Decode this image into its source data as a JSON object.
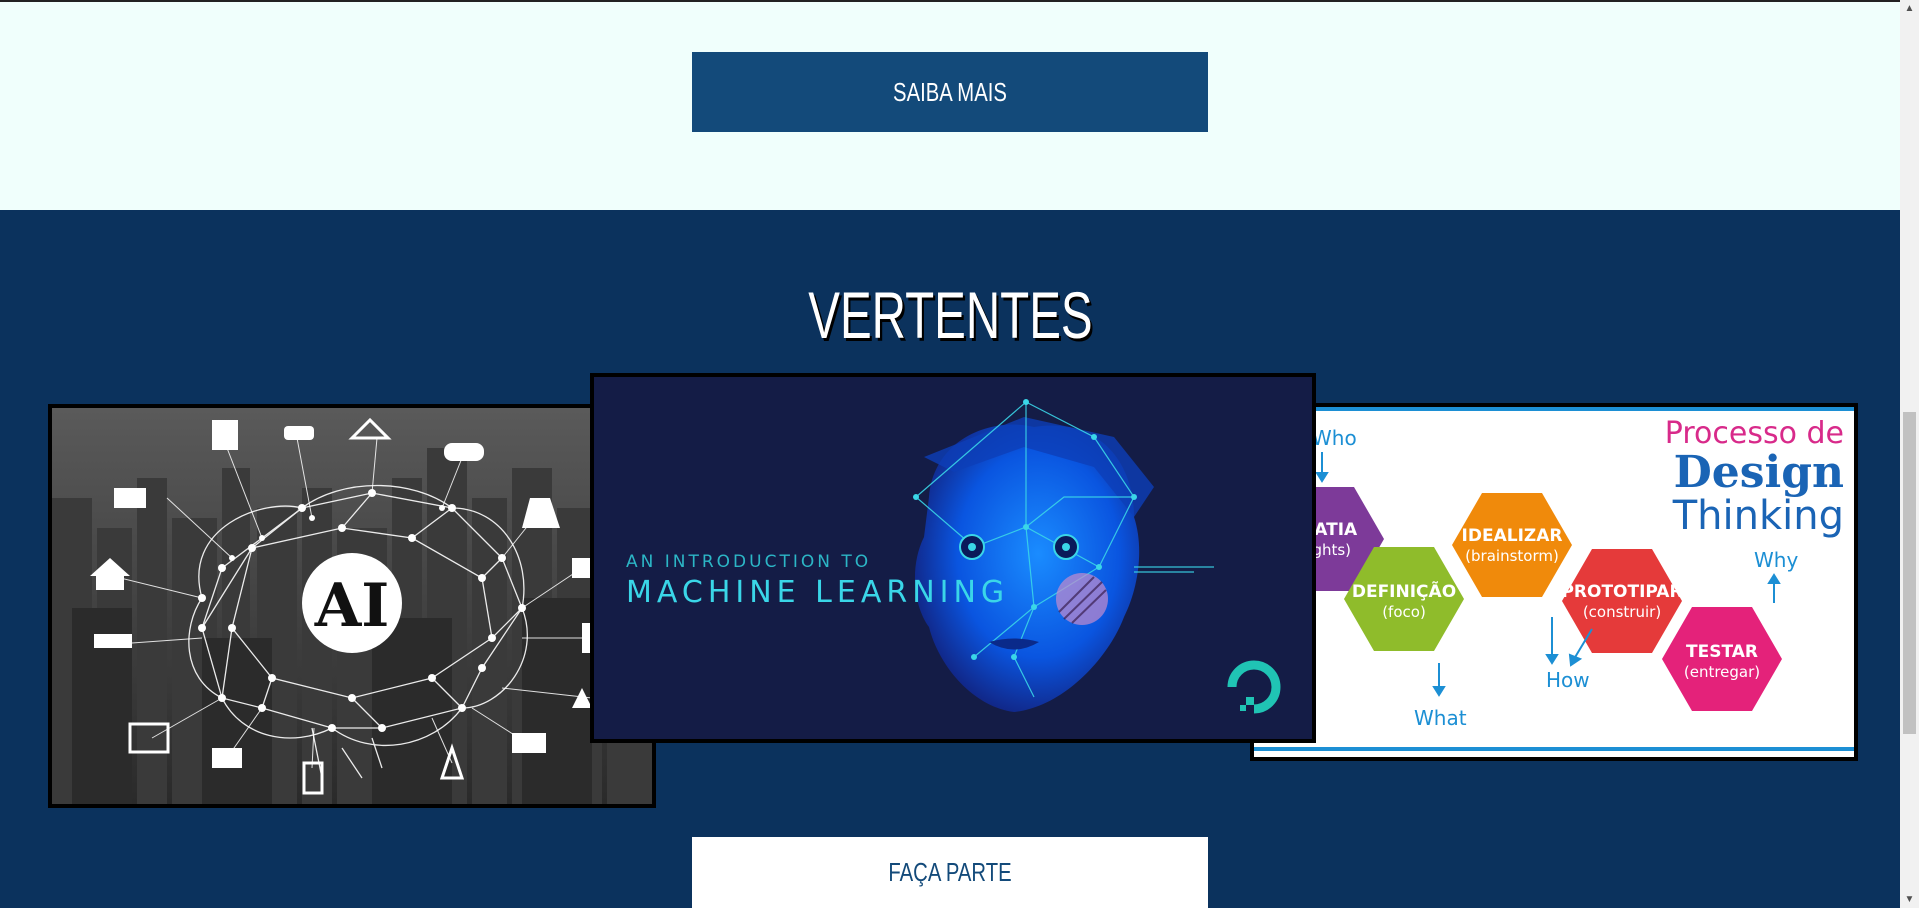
{
  "top_section": {
    "button_label": "SAIBA MAIS"
  },
  "vertentes": {
    "title": "VERTENTES",
    "cards": {
      "ai": {
        "badge": "AI"
      },
      "ml": {
        "subtitle": "AN INTRODUCTION TO",
        "title": "MACHINE LEARNING"
      },
      "dt": {
        "heading_1": "Processo de",
        "heading_2": "Design",
        "heading_3": "Thinking",
        "who": "Who",
        "what": "What",
        "how": "How",
        "why": "Why",
        "steps": [
          {
            "name": "EMPATIA",
            "sub": "(insights)"
          },
          {
            "name": "DEFINIÇÃO",
            "sub": "(foco)"
          },
          {
            "name": "IDEALIZAR",
            "sub": "(brainstorm)"
          },
          {
            "name": "PROTOTIPAR",
            "sub": "(construir)"
          },
          {
            "name": "TESTAR",
            "sub": "(entregar)"
          }
        ]
      }
    },
    "button_label": "FAÇA PARTE"
  },
  "scrollbar": {
    "up": "▲",
    "down": "▼"
  },
  "colors": {
    "navy": "#0b325d",
    "button_blue": "#134a7a",
    "light_bg": "#f0fffc"
  }
}
